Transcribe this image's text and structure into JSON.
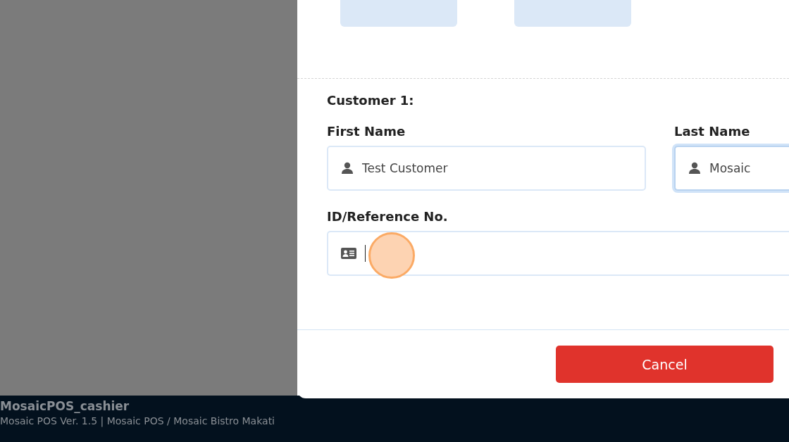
{
  "top_tiles": [
    {
      "kind": "tile"
    },
    {
      "kind": "tile"
    }
  ],
  "customer": {
    "heading": "Customer 1:",
    "fields": [
      {
        "kind": "name",
        "label": "First Name",
        "value": "Test Customer",
        "focused": false,
        "caret": false
      },
      {
        "kind": "name",
        "label": "Last Name",
        "value": "Mosaic",
        "focused": true,
        "caret": false
      }
    ],
    "id_field": {
      "kind": "id",
      "label": "ID/Reference No.",
      "focused": false,
      "caret": true
    }
  },
  "cancel_button": "Cancel",
  "status_bar": {
    "user": "MosaicPOS_cashier",
    "info": "Mosaic POS Ver. 1.5 | Mosaic POS / Mosaic Bistro Makati"
  }
}
